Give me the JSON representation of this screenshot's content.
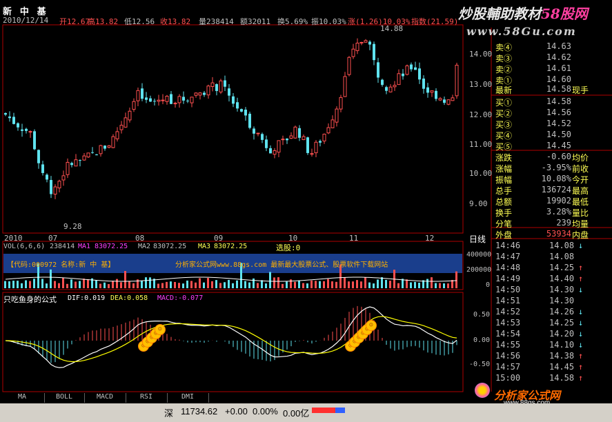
{
  "header": {
    "stock_name": "新 中 基",
    "date": "2010/12/14",
    "open_label": "开12.67",
    "high_label": "高13.82",
    "low_label": "低12.56",
    "close_label": "收13.82",
    "volume_label": "量238414",
    "amount_label": "额32011",
    "turnover_label": "换5.69%",
    "amplitude_label": "振10.03%",
    "change_label": "涨(1.26)10.03%",
    "index_label": "指数(21.59)",
    "arrow": "↑"
  },
  "watermark": {
    "title": "炒股輔助教材",
    "brand": "58股网",
    "url": "www.58Gu.com"
  },
  "main_chart": {
    "price_high_marker": "14.88",
    "price_low_marker": "9.28",
    "y_ticks": [
      "14.00",
      "13.00",
      "12.00",
      "11.00",
      "10.00",
      "9.00"
    ],
    "x_ticks": [
      "2010",
      "07",
      "08",
      "09",
      "10",
      "11",
      "12"
    ],
    "period": "日线"
  },
  "volume_panel": {
    "header_label": "VOL(6,6,6)",
    "vol_value": "238414",
    "ma1_label": "MA1",
    "ma1_value": "83072.25",
    "ma2_label": "MA2",
    "ma2_value": "83072.25",
    "ma3_label": "MA3",
    "ma3_value": "83072.25",
    "select_label": "选股:0",
    "banner_code": "【代码:000972  名称:新 中 基】",
    "banner_ad": "分析家公式网www.88gs.com 最新最大股票公式、股票软件下载网站",
    "y_ticks": [
      "400000",
      "200000",
      "0"
    ]
  },
  "macd_panel": {
    "title": "只吃鱼身的公式",
    "dif": "DIF:0.019",
    "dea": "DEA:0.058",
    "macd": "MACD:-0.077",
    "y_ticks": [
      "0.50",
      "0.00",
      "-0.50"
    ]
  },
  "quotes": {
    "sell": [
      {
        "label": "卖④",
        "value": "14.63"
      },
      {
        "label": "卖③",
        "value": "14.62"
      },
      {
        "label": "卖②",
        "value": "14.61"
      },
      {
        "label": "卖①",
        "value": "14.60"
      }
    ],
    "latest": {
      "label": "最新",
      "value": "14.58",
      "extra": "现手"
    },
    "buy": [
      {
        "label": "买①",
        "value": "14.58"
      },
      {
        "label": "买②",
        "value": "14.56"
      },
      {
        "label": "买③",
        "value": "14.52"
      },
      {
        "label": "买④",
        "value": "14.50"
      },
      {
        "label": "买⑤",
        "value": "14.45"
      }
    ],
    "stats": [
      {
        "label": "涨跌",
        "value": "-0.60",
        "extra": "均价"
      },
      {
        "label": "涨幅",
        "value": "-3.95%",
        "extra": "前收"
      },
      {
        "label": "振幅",
        "value": "10.08%",
        "extra": "今开"
      },
      {
        "label": "总手",
        "value": "136724",
        "extra": "最高"
      },
      {
        "label": "总额",
        "value": "19902",
        "extra": "最低"
      },
      {
        "label": "换手",
        "value": "3.28%",
        "extra": "量比"
      },
      {
        "label": "分笔",
        "value": "239",
        "extra": "均量"
      }
    ],
    "outer": {
      "label": "外盘",
      "value": "53934",
      "extra": "内盘"
    }
  },
  "ticks": [
    {
      "time": "14:46",
      "price": "14.08",
      "arrow": "↓",
      "color": "#5fe3ef"
    },
    {
      "time": "14:47",
      "price": "14.08",
      "arrow": "",
      "color": "#5fe3ef"
    },
    {
      "time": "14:48",
      "price": "14.25",
      "arrow": "↑",
      "color": "#ff5050"
    },
    {
      "time": "14:49",
      "price": "14.40",
      "arrow": "↑",
      "color": "#ff5050"
    },
    {
      "time": "14:50",
      "price": "14.30",
      "arrow": "↓",
      "color": "#5fe3ef"
    },
    {
      "time": "14:51",
      "price": "14.30",
      "arrow": "",
      "color": "#5fe3ef"
    },
    {
      "time": "14:52",
      "price": "14.26",
      "arrow": "↓",
      "color": "#5fe3ef"
    },
    {
      "time": "14:53",
      "price": "14.25",
      "arrow": "↓",
      "color": "#5fe3ef"
    },
    {
      "time": "14:54",
      "price": "14.20",
      "arrow": "↓",
      "color": "#5fe3ef"
    },
    {
      "time": "14:55",
      "price": "14.10",
      "arrow": "↓",
      "color": "#5fe3ef"
    },
    {
      "time": "14:56",
      "price": "14.38",
      "arrow": "↑",
      "color": "#ff5050"
    },
    {
      "time": "14:57",
      "price": "14.45",
      "arrow": "↑",
      "color": "#ff5050"
    },
    {
      "time": "15:00",
      "price": "14.58",
      "arrow": "↑",
      "color": "#ff5050"
    }
  ],
  "tabs": [
    "MA",
    "BOLL",
    "MACD",
    "RSI",
    "DMI"
  ],
  "status_bar": {
    "market": "深",
    "index_value": "11734.62",
    "change": "+0.00",
    "percent": "0.00%",
    "amount": "0.00亿"
  },
  "logo": {
    "name": "分析家公式网",
    "url": "www.88gs.com"
  },
  "colors": {
    "up": "#ff5050",
    "down": "#5fe3ef",
    "grid_border": "#b00000",
    "white_line": "#ffffff",
    "yellow_line": "#ffff00",
    "label_yellow": "#ffff54",
    "banner_bg": "#1a3e8c"
  }
}
